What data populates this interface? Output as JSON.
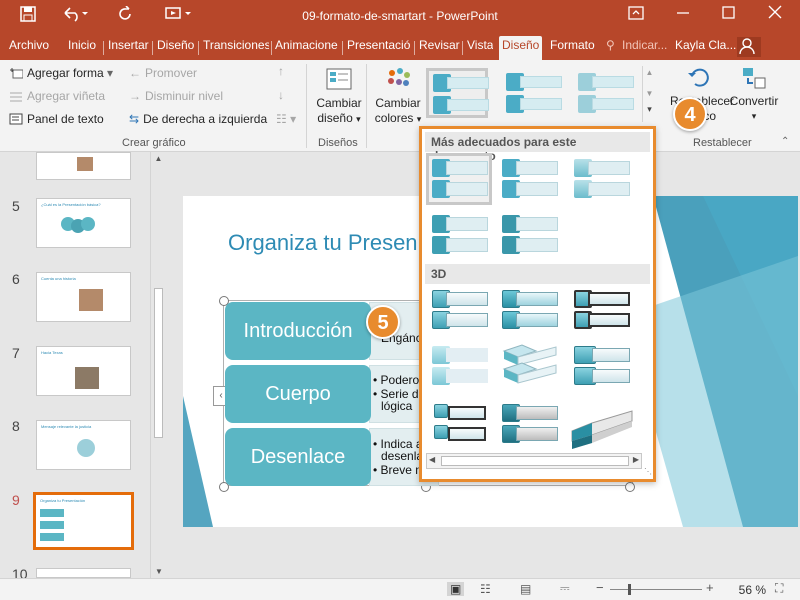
{
  "titlebar": {
    "title": "09-formato-de-smartart - PowerPoint",
    "save_icon": "floppy-disk-icon",
    "undo_icon": "undo-arrow-icon",
    "redo_icon": "redo-icon",
    "present_icon": "present-icon"
  },
  "tabs": [
    {
      "label": "Archivo"
    },
    {
      "label": "Inicio"
    },
    {
      "label": "Insertar"
    },
    {
      "label": "Diseño"
    },
    {
      "label": "Transiciones"
    },
    {
      "label": "Animaciones"
    },
    {
      "label": "Presentació"
    },
    {
      "label": "Revisar"
    },
    {
      "label": "Vista"
    },
    {
      "label": "Diseño"
    },
    {
      "label": "Formato"
    },
    {
      "label": "Indicar..."
    },
    {
      "label": "Kayla Cla..."
    }
  ],
  "ribbon": {
    "crear_grafico": {
      "agregar_forma": "Agregar forma",
      "agregar_vineta": "Agregar viñeta",
      "panel_de_texto": "Panel de texto",
      "promover": "Promover",
      "disminuir_nivel": "Disminuir nivel",
      "derecha_izquierda": "De derecha a izquierda",
      "group_label": "Crear gráfico"
    },
    "disenos": {
      "cambiar_diseno_1": "Cambiar",
      "cambiar_diseno_2": "diseño",
      "group_label": "Diseños"
    },
    "estilos": {
      "cambiar_colores_1": "Cambiar",
      "cambiar_colores_2": "colores"
    },
    "restablecer": {
      "restablecer_1": "Restablecer",
      "restablecer_2": "gráfico",
      "convertir": "Convertir",
      "group_label": "Restablecer"
    }
  },
  "slides": [
    {
      "num": "5",
      "caption": "¿Cuál es la Presentación básica?"
    },
    {
      "num": "6",
      "caption": "Cuenta una historia"
    },
    {
      "num": "7",
      "caption": "Hacia Texas"
    },
    {
      "num": "8",
      "caption": "Mensaje relevante la justicia"
    },
    {
      "num": "9",
      "caption": "Organiza tu Presentación"
    },
    {
      "num": "10",
      "caption": ""
    }
  ],
  "slide": {
    "title": "Organiza tu Presen",
    "boxes": [
      "Introducción",
      "Cuerpo",
      "Desenlace"
    ],
    "bullets": {
      "intro": [
        "• g",
        "Engánc"
      ],
      "cuerpo": [
        "• Podero",
        "• Serie d",
        "lógica"
      ],
      "desenlace": [
        "• Indica a",
        "desenla",
        "• Breve n"
      ]
    }
  },
  "gallery": {
    "section1": "Más adecuados para este documento",
    "section2": "3D"
  },
  "callouts": {
    "four": "4",
    "five": "5"
  },
  "status": {
    "zoom": "56 %"
  },
  "colors": {
    "accent": "#b7472a",
    "highlight": "#e88b2e",
    "smartart": "#5bb6c4"
  }
}
